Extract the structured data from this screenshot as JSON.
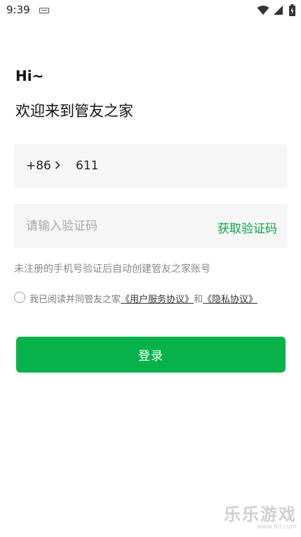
{
  "status_bar": {
    "time": "9:39",
    "icons": [
      "keyboard-icon",
      "wifi-icon",
      "signal-icon",
      "battery-icon"
    ]
  },
  "greeting": {
    "hi": "Hi~",
    "welcome": "欢迎来到管友之家"
  },
  "phone": {
    "country_code": "+86",
    "chevron": "chevron-right-icon",
    "value": "611"
  },
  "code": {
    "placeholder": "请输入验证码",
    "get_code_label": "获取验证码"
  },
  "notice": "未注册的手机号验证后自动创建管友之家账号",
  "agreement": {
    "prefix": "我已阅读并同管友之家",
    "user_agreement": "《用户服务协议》",
    "and": "和",
    "privacy": "《隐私协议》"
  },
  "login_label": "登录",
  "watermark": {
    "main": "乐乐游戏",
    "url": "www.6ll.com"
  },
  "colors": {
    "accent": "#08b24a",
    "link_green": "#0aa545",
    "input_bg": "#f6f6f6"
  }
}
